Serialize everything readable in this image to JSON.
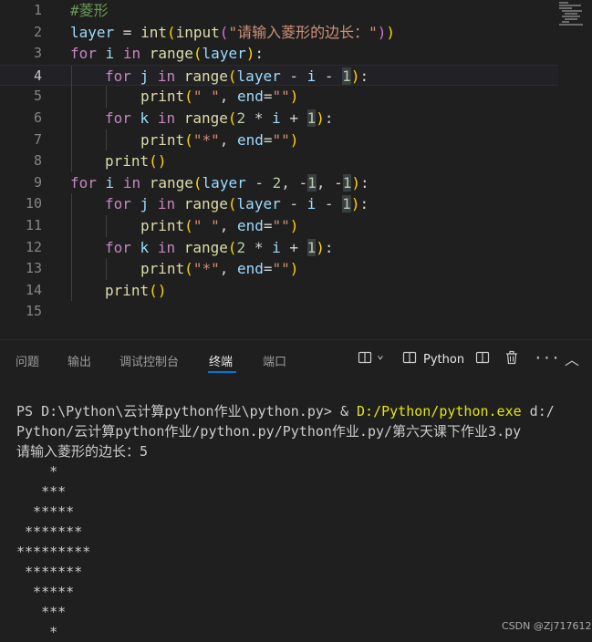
{
  "editor": {
    "line_numbers": [
      "1",
      "2",
      "3",
      "4",
      "5",
      "6",
      "7",
      "8",
      "9",
      "10",
      "11",
      "12",
      "13",
      "14",
      "15"
    ],
    "code_tokens": {
      "l1": [
        "#菱形"
      ],
      "l2": [
        "layer",
        " = ",
        "int",
        "(",
        "input",
        "(",
        "\"请输入菱形的边长：\"",
        ")",
        ")"
      ],
      "l3": [
        "for",
        " ",
        "i",
        " ",
        "in",
        " ",
        "range",
        "(",
        "layer",
        ")",
        ":"
      ],
      "l4": [
        "for",
        " ",
        "j",
        " ",
        "in",
        " ",
        "range",
        "(",
        "layer",
        " - ",
        "i",
        " - ",
        "1",
        ")",
        ":"
      ],
      "l5": [
        "print",
        "(",
        "\" \"",
        ", ",
        "end",
        "=",
        "\"\"",
        ")"
      ],
      "l6": [
        "for",
        " ",
        "k",
        " ",
        "in",
        " ",
        "range",
        "(",
        "2",
        " * ",
        "i",
        " + ",
        "1",
        ")",
        ":"
      ],
      "l7": [
        "print",
        "(",
        "\"*\"",
        ", ",
        "end",
        "=",
        "\"\"",
        ")"
      ],
      "l8": [
        "print",
        "(",
        ")"
      ],
      "l9": [
        "for",
        " ",
        "i",
        " ",
        "in",
        " ",
        "range",
        "(",
        "layer",
        " - ",
        "2",
        ", ",
        "-",
        "1",
        ", ",
        "-",
        "1",
        ")",
        ":"
      ],
      "l10": [
        "for",
        " ",
        "j",
        " ",
        "in",
        " ",
        "range",
        "(",
        "layer",
        " - ",
        "i",
        " - ",
        "1",
        ")",
        ":"
      ],
      "l11": [
        "print",
        "(",
        "\" \"",
        ", ",
        "end",
        "=",
        "\"\"",
        ")"
      ],
      "l12": [
        "for",
        " ",
        "k",
        " ",
        "in",
        " ",
        "range",
        "(",
        "2",
        " * ",
        "i",
        " + ",
        "1",
        ")",
        ":"
      ],
      "l13": [
        "print",
        "(",
        "\"*\"",
        ", ",
        "end",
        "=",
        "\"\"",
        ")"
      ],
      "l14": [
        "print",
        "(",
        ")"
      ]
    }
  },
  "panel": {
    "tabs": [
      "问题",
      "输出",
      "调试控制台",
      "终端",
      "端口"
    ],
    "active_tab": "终端",
    "terminal_profile": "Python"
  },
  "terminal": {
    "prompt": "PS D:\\Python\\云计算python作业\\python.py> ",
    "amp": "& ",
    "exe": "D:/Python/python.exe",
    "arg1": " d:/",
    "arg2": "Python/云计算python作业/python.py/Python作业.py/第六天课下作业3.py",
    "input_line": "请输入菱形的边长：5",
    "output_lines": [
      "    *",
      "   ***",
      "  *****",
      " *******",
      "*********",
      " *******",
      "  *****",
      "   ***",
      "    *"
    ]
  },
  "watermark": "CSDN @Zj717612",
  "colors": {
    "background": "#1f1f1f",
    "keyword": "#c586c0",
    "function": "#dcdcaa",
    "variable": "#9cdcfe",
    "string": "#ce9178",
    "number": "#b5cea8",
    "comment": "#6a9955",
    "accent": "#0078d4"
  }
}
